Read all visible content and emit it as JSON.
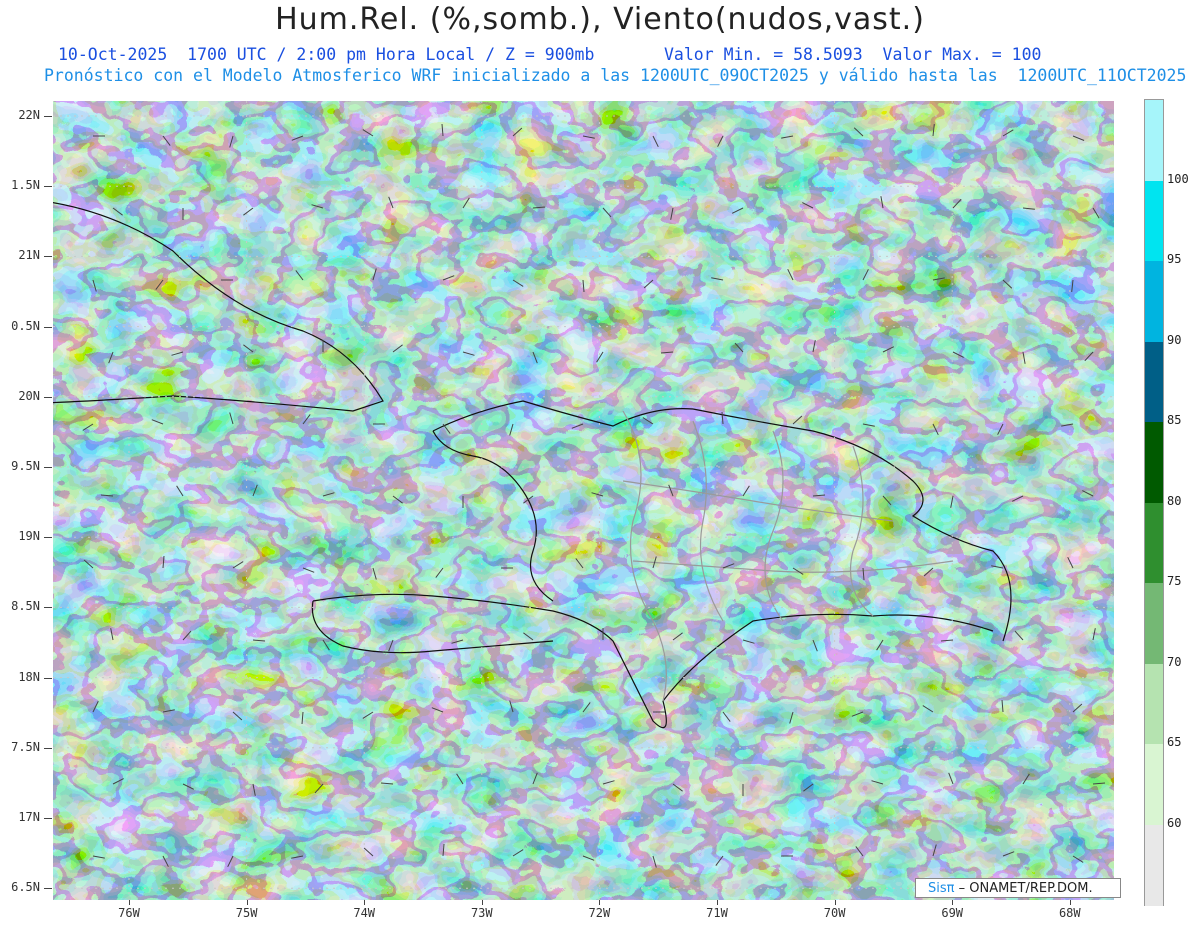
{
  "title": "Hum.Rel. (%,somb.), Viento(nudos,vast.)",
  "subtitle_line1": "10-Oct-2025  1700 UTC / 2:00 pm Hora Local / Z = 900mb       Valor Min. = 58.5093  Valor Max. = 100",
  "subtitle_line2": "Pronóstico con el Modelo Atmosferico WRF inicializado a las 1200UTC_09OCT2025 y válido hasta las  1200UTC_11OCT2025",
  "lat_labels": [
    "22N",
    "1.5N",
    "21N",
    "0.5N",
    "20N",
    "9.5N",
    "19N",
    "8.5N",
    "18N",
    "7.5N",
    "17N",
    "6.5N"
  ],
  "lon_labels": [
    "76W",
    "75W",
    "74W",
    "73W",
    "72W",
    "71W",
    "70W",
    "69W",
    "68W"
  ],
  "colorbar": {
    "labels": [
      "100",
      "95",
      "90",
      "85",
      "80",
      "75",
      "70",
      "65",
      "60"
    ],
    "colors": [
      "#a6f5fa",
      "#00e4f0",
      "#00b4e0",
      "#005f87",
      "#005a00",
      "#2f8f2f",
      "#74b874",
      "#b5e3b0",
      "#d9f5d2",
      "#e8e8e8"
    ]
  },
  "credit": {
    "brand": "Sisπ",
    "text": " – ONAMET/REP.DOM."
  }
}
